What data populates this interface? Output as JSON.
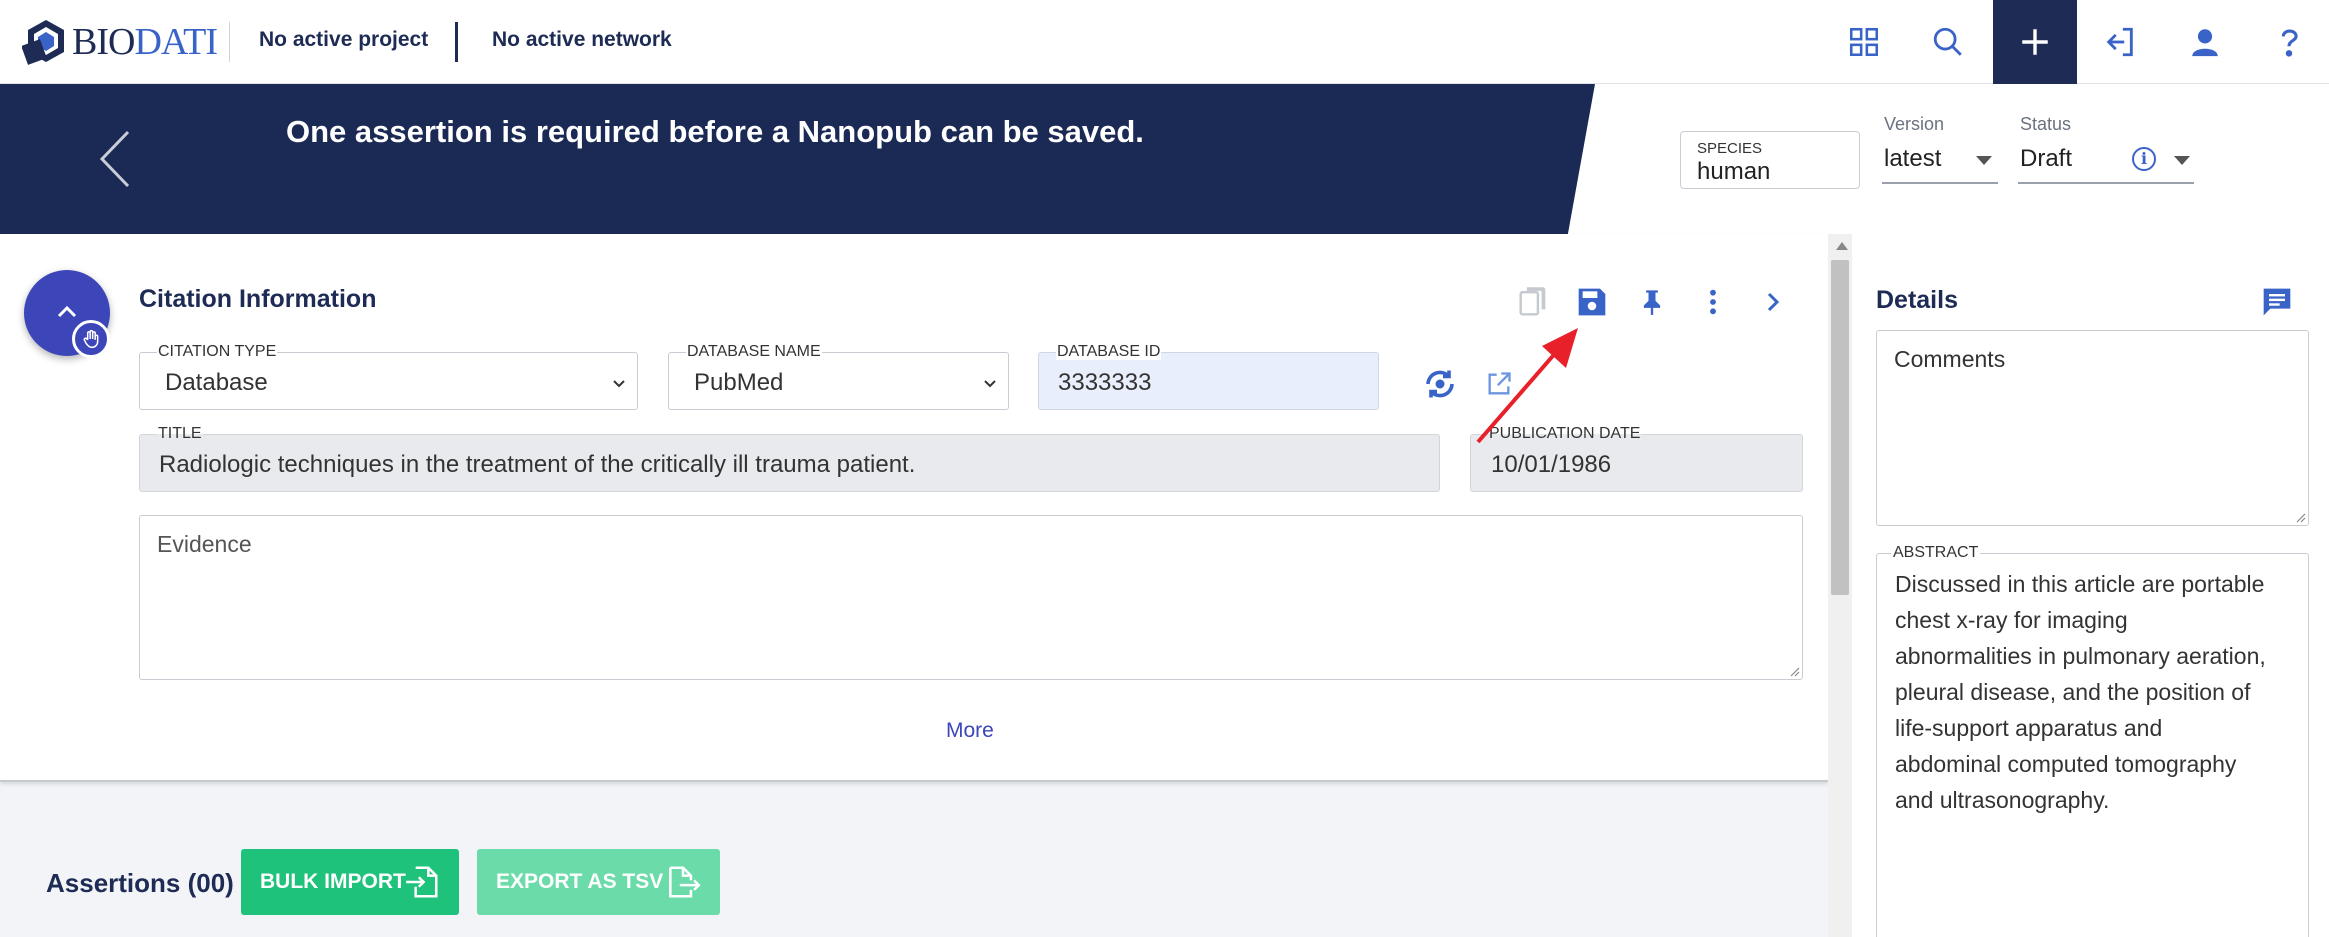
{
  "topbar": {
    "logo_text_bio": "BIO",
    "logo_text_dati": "DATI",
    "project": "No active project",
    "network": "No active network"
  },
  "banner": {
    "message": "One assertion is required before a Nanopub can be saved.",
    "species_label": "SPECIES",
    "species_value": "human",
    "version_label": "Version",
    "version_value": "latest",
    "status_label": "Status",
    "status_value": "Draft"
  },
  "citation": {
    "title": "Citation Information",
    "citation_type_label": "CITATION TYPE",
    "citation_type_value": "Database",
    "database_name_label": "DATABASE NAME",
    "database_name_value": "PubMed",
    "database_id_label": "DATABASE ID",
    "database_id_value": "3333333",
    "title_label": "TITLE",
    "title_value": "Radiologic techniques in the treatment of the critically ill trauma patient.",
    "pub_date_label": "PUBLICATION DATE",
    "pub_date_value": "10/01/1986",
    "evidence_placeholder": "Evidence",
    "more_link": "More"
  },
  "assertions": {
    "title": "Assertions (00)",
    "bulk_import": "BULK IMPORT",
    "export_tsv": "EXPORT AS TSV"
  },
  "details": {
    "title": "Details",
    "comments_placeholder": "Comments",
    "abstract_label": "ABSTRACT",
    "abstract_lines": [
      "Discussed in this article are portable",
      "chest x-ray for imaging",
      "abnormalities in pulmonary aeration,",
      "pleural disease, and the position of",
      "life-support apparatus and",
      "abdominal computed tomography",
      "and ultrasonography."
    ]
  },
  "colors": {
    "navy": "#1b2a55",
    "accent_blue": "#3a63c8",
    "fab": "#3c46b9",
    "green": "#1ec27a",
    "green_light": "#6bdba9",
    "annotation_arrow": "#e8202a"
  }
}
